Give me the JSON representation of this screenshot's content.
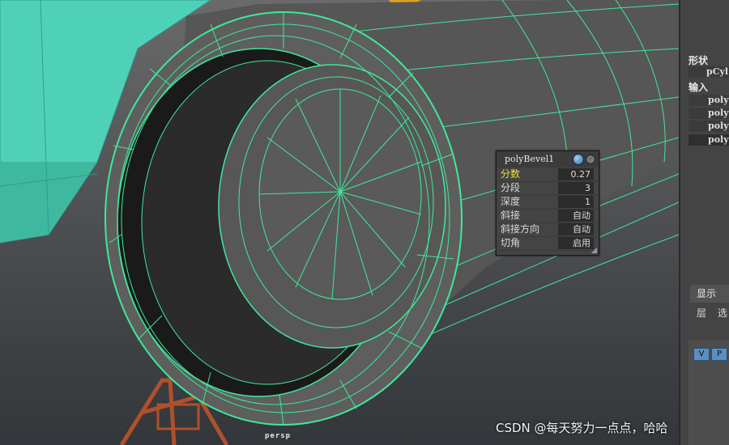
{
  "viewport": {
    "camera_label": "persp"
  },
  "right_panel": {
    "shape_heading": "形状",
    "shape_item": "pCyl",
    "inputs_heading": "输入",
    "input_items": [
      "poly",
      "poly",
      "poly",
      "poly"
    ]
  },
  "layer_panel": {
    "tab_label": "显示",
    "menu_layers": "层",
    "menu_options": "选",
    "v_label": "V",
    "p_label": "P"
  },
  "bevel_panel": {
    "title": "polyBevel1",
    "rows": [
      {
        "label": "分数",
        "value": "0.27",
        "highlight": true
      },
      {
        "label": "分段",
        "value": "3",
        "highlight": false
      },
      {
        "label": "深度",
        "value": "1",
        "highlight": false
      },
      {
        "label": "斜接",
        "value": "自动",
        "highlight": false
      },
      {
        "label": "斜接方向",
        "value": "自动",
        "highlight": false
      },
      {
        "label": "切角",
        "value": "启用",
        "highlight": false
      }
    ]
  },
  "watermark": "CSDN @每天努力一点点，哈哈",
  "colors": {
    "wire": "#3fe89a",
    "mesh_face": "#5b5b5b",
    "background_mesh": "#4fd1b8",
    "selected_highlight": "#f0e03c"
  }
}
